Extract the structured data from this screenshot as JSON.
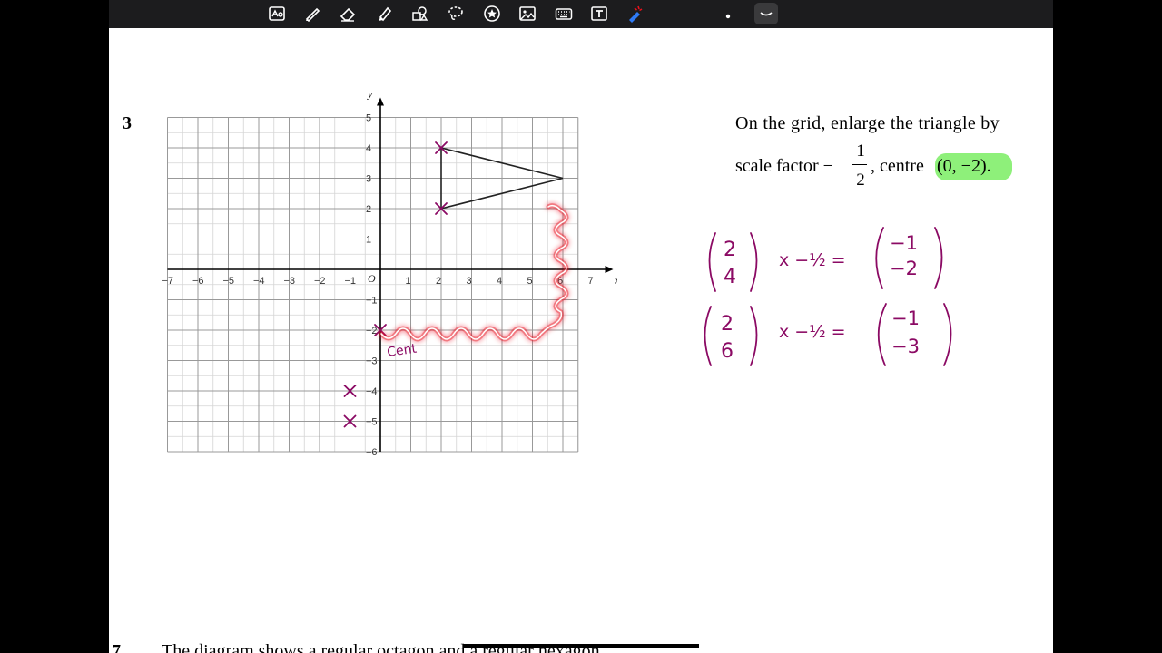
{
  "toolbar": {
    "tools": [
      {
        "name": "text-recognition-icon"
      },
      {
        "name": "pen-icon"
      },
      {
        "name": "eraser-icon"
      },
      {
        "name": "highlighter-icon"
      },
      {
        "name": "shapes-icon"
      },
      {
        "name": "lasso-icon"
      },
      {
        "name": "sticker-icon"
      },
      {
        "name": "image-icon"
      },
      {
        "name": "keyboard-icon"
      },
      {
        "name": "text-box-icon"
      },
      {
        "name": "laser-pointer-icon"
      }
    ],
    "accent": "#2f7bf6"
  },
  "question": {
    "number": "3",
    "line1": "On the grid, enlarge the triangle by",
    "line2_prefix": "scale factor −",
    "frac_num": "1",
    "frac_den": "2",
    "line2_mid": ", centre",
    "centre_value": "(0, −2).",
    "highlight_color": "#8ef07a"
  },
  "chart_data": {
    "type": "scatter",
    "xlabel": "x",
    "ylabel": "y",
    "origin_label": "O",
    "xlim": [
      -7,
      7
    ],
    "ylim": [
      -6,
      5
    ],
    "x_ticks": [
      "−7",
      "−6",
      "−5",
      "−4",
      "−3",
      "−2",
      "−1",
      "1",
      "2",
      "3",
      "4",
      "5",
      "6",
      "7"
    ],
    "y_ticks": [
      "5",
      "4",
      "3",
      "2",
      "1",
      "−1",
      "−2",
      "−3",
      "−4",
      "−5",
      "−6"
    ],
    "grid": true,
    "triangle": [
      [
        2,
        4
      ],
      [
        6,
        3
      ],
      [
        2,
        2
      ]
    ],
    "marked_points": [
      [
        2,
        4
      ],
      [
        2,
        2
      ],
      [
        0,
        -2
      ],
      [
        -1,
        -4
      ],
      [
        -1,
        -5
      ]
    ]
  },
  "handwriting": {
    "color": "#8b0a64",
    "row1": {
      "vec": [
        "2",
        "4"
      ],
      "op": "x −½ =",
      "result": [
        "−1",
        "−2"
      ]
    },
    "row2": {
      "vec": [
        "2",
        "6"
      ],
      "op": "x −½ =",
      "result": [
        "−1",
        "−3"
      ]
    },
    "centre_note": "Cent"
  },
  "laser_color": "#e8101a",
  "next_question": {
    "number": "7",
    "text": "The diagram shows a regular octagon and a regular hexagon."
  }
}
